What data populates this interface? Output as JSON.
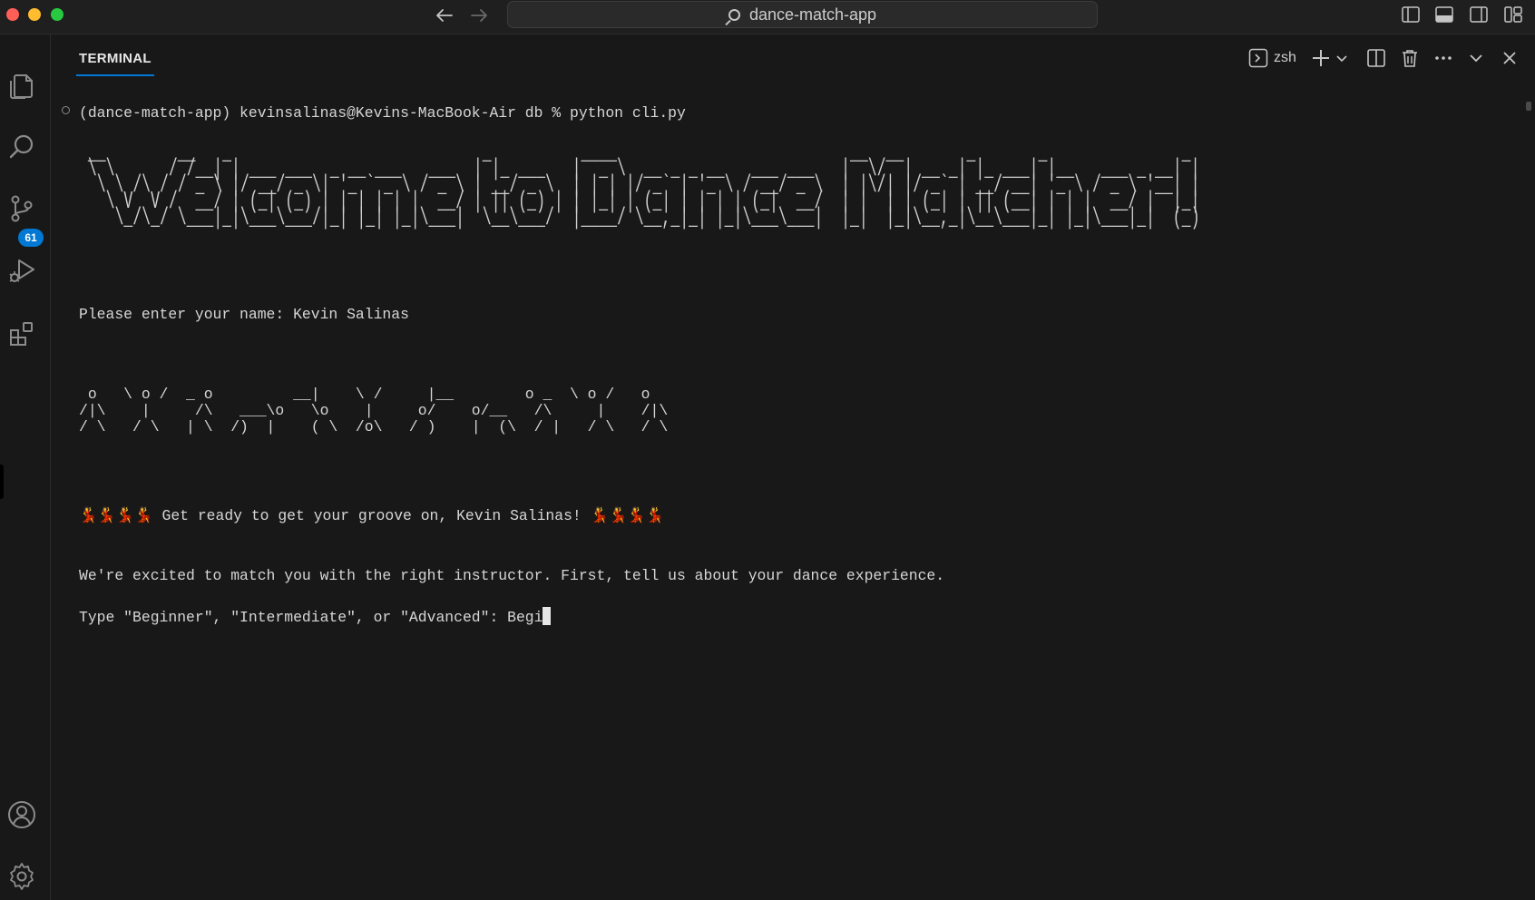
{
  "window": {
    "title": "dance-match-app"
  },
  "titlebar": {
    "nav_back_icon": "arrow-left-icon",
    "nav_forward_icon": "arrow-right-icon",
    "search_icon": "search-icon",
    "layout_icons": [
      "toggle-primary-sidebar-icon",
      "toggle-panel-icon",
      "toggle-secondary-sidebar-icon",
      "customize-layout-icon"
    ]
  },
  "activity_bar": {
    "items": [
      {
        "name": "explorer",
        "icon": "files-icon"
      },
      {
        "name": "search",
        "icon": "search-icon"
      },
      {
        "name": "source-control",
        "icon": "source-control-icon",
        "badge": "61"
      },
      {
        "name": "run-and-debug",
        "icon": "run-debug-icon"
      },
      {
        "name": "extensions",
        "icon": "extensions-icon"
      }
    ],
    "bottom": [
      {
        "name": "accounts",
        "icon": "account-icon"
      },
      {
        "name": "manage",
        "icon": "gear-icon"
      }
    ]
  },
  "panel": {
    "tab_label": "TERMINAL",
    "shell_name": "zsh",
    "actions": [
      "new-terminal-icon",
      "launch-profile-chevron-icon",
      "split-terminal-icon",
      "kill-terminal-icon",
      "more-actions-icon",
      "collapse-panel-icon",
      "close-panel-icon"
    ]
  },
  "terminal": {
    "command_line": "(dance-match-app) kevinsalinas@Kevins-MacBook-Air db % python cli.py",
    "banner_ascii": " __        __   _                            _          ____                          __  __       _       _               _ \n \\ \\      / /__| | ___ ___  _ __ ___   ___  | |_ ___   |  _ \\  __ _ _ __   ___ ___   |  \\/  | __ _| |_ ___| |__   ___ _ __| |\n  \\ \\ /\\ / / _ \\ |/ __/ _ \\| '_ ` _ \\ / _ \\ | __/ _ \\  | | | |/ _` | '_ \\ / __/ _ \\  | |\\/| |/ _` | __/ __| '_ \\ / _ \\ '__| |\n   \\ V  V /  __/ | (_| (_) | | | | | |  __/ | || (_) | | |_| | (_| | | | | (_|  __/  | |  | | (_| | || (__| | | |  __/ |  |_|\n    \\_/\\_/ \\___|_|\\___\\___/|_| |_| |_|\\___|  \\__\\___/  |____/ \\__,_|_| |_|\\___\\___|  |_|  |_|\\__,_|\\__\\___|_| |_|\\___|_|  (_)",
    "name_prompt": "Please enter your name: Kevin Salinas",
    "dancers_ascii": " o   \\ o /  _ o         __|    \\ /     |__        o _  \\ o /   o\n/|\\    |     /\\   ___\\o   \\o    |     o/    o/__   /\\     |    /|\\\n/ \\   / \\   | \\  /)  |    ( \\  /o\\   / )    |  (\\  / |   / \\   / \\",
    "groove_emoji_left": "💃💃💃💃",
    "groove_text": " Get ready to get your groove on, Kevin Salinas! ",
    "groove_emoji_right": "💃💃💃💃",
    "excited_line": "We're excited to match you with the right instructor. First, tell us about your dance experience.",
    "experience_prompt": "Type \"Beginner\", \"Intermediate\", or \"Advanced\": Begi"
  }
}
